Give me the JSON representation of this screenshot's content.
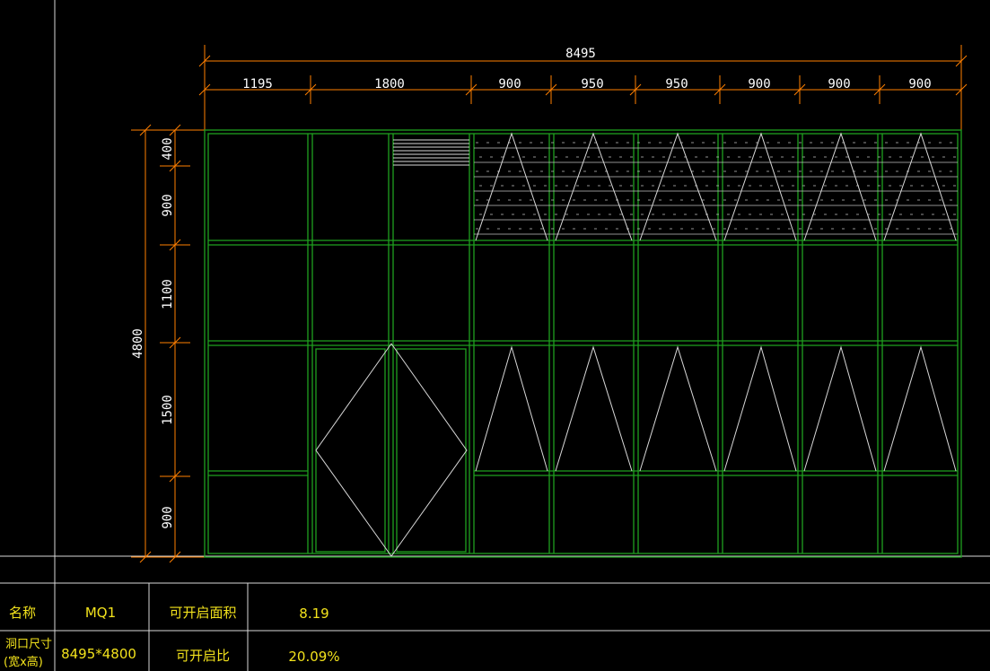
{
  "drawing": {
    "overall_width_label": "8495",
    "overall_height_label": "4800",
    "column_width_labels": [
      "1195",
      "1800",
      "900",
      "950",
      "950",
      "900",
      "900",
      "900"
    ],
    "row_height_labels": [
      "400",
      "900",
      "1100",
      "1500",
      "900"
    ]
  },
  "table": {
    "name_label": "名称",
    "name_value": "MQ1",
    "opening_area_label": "可开启面积",
    "opening_area_value": "8.19",
    "size_label_line1": "洞口尺寸",
    "size_label_line2": "(宽x高)",
    "size_value": "8495*4800",
    "opening_ratio_label": "可开启比",
    "opening_ratio_value": "20.09%"
  },
  "colors": {
    "background": "#000000",
    "frame": "#1fa01f",
    "dimension": "#ff7f00",
    "text": "#ffffff",
    "table_text": "#f2e21c",
    "grid_line": "#d8d8d8",
    "hatch": "#bfbfbf"
  }
}
